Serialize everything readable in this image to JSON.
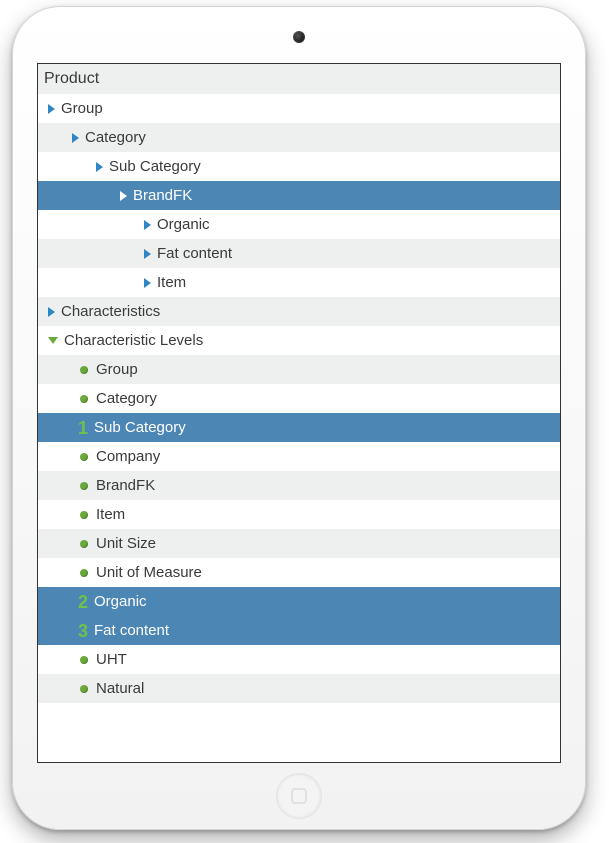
{
  "header": "Product",
  "rows": [
    {
      "label": "Group",
      "indent": 10,
      "icon": "arrow",
      "bg": "white",
      "sel": false
    },
    {
      "label": "Category",
      "indent": 34,
      "icon": "arrow",
      "bg": "stripe",
      "sel": false
    },
    {
      "label": "Sub Category",
      "indent": 58,
      "icon": "arrow",
      "bg": "white",
      "sel": false
    },
    {
      "label": "BrandFK",
      "indent": 82,
      "icon": "arrow-w",
      "bg": "sel",
      "sel": true
    },
    {
      "label": "Organic",
      "indent": 106,
      "icon": "arrow",
      "bg": "white",
      "sel": false
    },
    {
      "label": "Fat content",
      "indent": 106,
      "icon": "arrow",
      "bg": "stripe",
      "sel": false
    },
    {
      "label": "Item",
      "indent": 106,
      "icon": "arrow",
      "bg": "white",
      "sel": false
    },
    {
      "label": "Characteristics",
      "indent": 10,
      "icon": "arrow",
      "bg": "stripe",
      "sel": false
    },
    {
      "label": "Characteristic Levels",
      "indent": 10,
      "icon": "arrow-down",
      "bg": "white",
      "sel": false
    },
    {
      "label": "Group",
      "indent": 42,
      "icon": "bullet",
      "bg": "stripe",
      "sel": false
    },
    {
      "label": "Category",
      "indent": 42,
      "icon": "bullet",
      "bg": "white",
      "sel": false
    },
    {
      "label": "Sub Category",
      "indent": 38,
      "icon": "num",
      "num": "1",
      "bg": "sel",
      "sel": true
    },
    {
      "label": "Company",
      "indent": 42,
      "icon": "bullet",
      "bg": "white",
      "sel": false
    },
    {
      "label": "BrandFK",
      "indent": 42,
      "icon": "bullet",
      "bg": "stripe",
      "sel": false
    },
    {
      "label": "Item",
      "indent": 42,
      "icon": "bullet",
      "bg": "white",
      "sel": false
    },
    {
      "label": "Unit Size",
      "indent": 42,
      "icon": "bullet",
      "bg": "stripe",
      "sel": false
    },
    {
      "label": "Unit of Measure",
      "indent": 42,
      "icon": "bullet",
      "bg": "white",
      "sel": false
    },
    {
      "label": "Organic",
      "indent": 38,
      "icon": "num",
      "num": "2",
      "bg": "sel",
      "sel": true
    },
    {
      "label": "Fat content",
      "indent": 38,
      "icon": "num",
      "num": "3",
      "bg": "sel",
      "sel": true
    },
    {
      "label": "UHT",
      "indent": 42,
      "icon": "bullet",
      "bg": "white",
      "sel": false
    },
    {
      "label": "Natural",
      "indent": 42,
      "icon": "bullet",
      "bg": "stripe",
      "sel": false
    }
  ]
}
